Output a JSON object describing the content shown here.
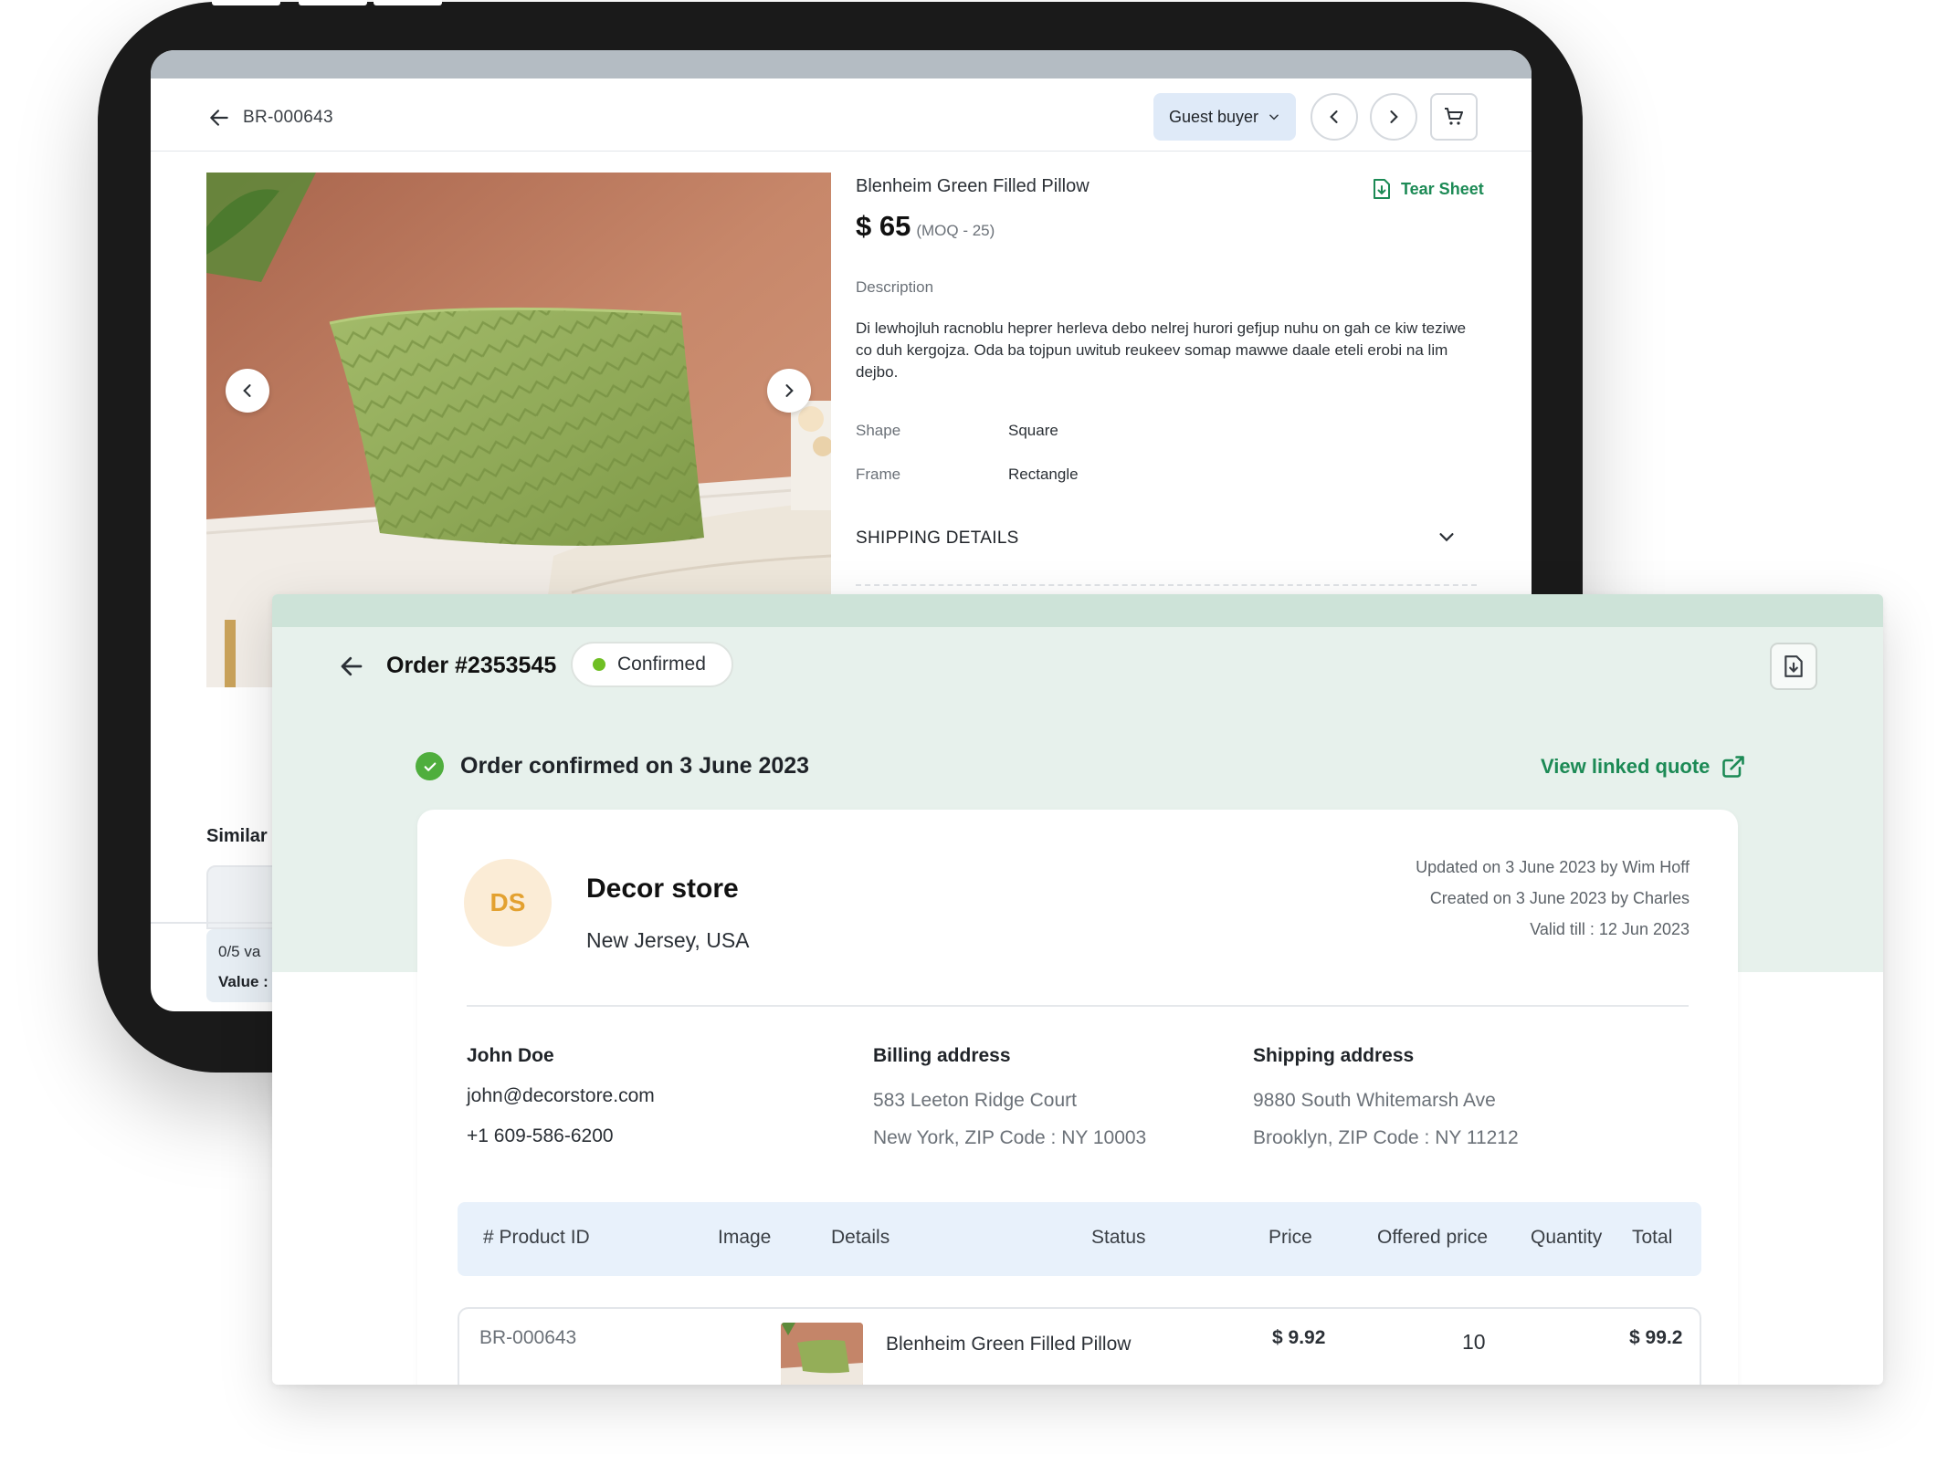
{
  "product_page": {
    "breadcrumb_code": "BR-000643",
    "buyer_select": "Guest buyer",
    "icons": {
      "back": "arrow-left-icon",
      "prev": "chevron-left-icon",
      "next": "chevron-right-icon",
      "cart": "cart-icon",
      "tear_sheet": "file-download-icon"
    },
    "product_name": "Blenheim Green Filled Pillow",
    "price": "$ 65",
    "moq": "(MOQ - 25)",
    "tear_sheet_label": "Tear Sheet",
    "description_label": "Description",
    "description": "Di lewhojluh racnoblu heprer herleva debo nelrej hurori gefjup nuhu on gah ce kiw teziwe co duh kergojza. Oda ba tojpun uwitub reukeev somap mawwe daale eteli erobi na lim dejbo.",
    "attributes": [
      {
        "key": "Shape",
        "value": "Square"
      },
      {
        "key": "Frame",
        "value": "Rectangle"
      }
    ],
    "shipping_label": "SHIPPING DETAILS",
    "similar_label": "Similar",
    "variants_text": "0/5 va",
    "value_text": "Value :"
  },
  "order": {
    "title": "Order #2353545",
    "status": "Confirmed",
    "status_color": "#6fbf24",
    "confirmed_text": "Order confirmed on 3 June 2023",
    "linked_quote": "View linked quote",
    "accent_color": "#1c8a55",
    "store": {
      "initials": "DS",
      "name": "Decor store",
      "location": "New Jersey, USA"
    },
    "meta": {
      "updated": "Updated on 3 June 2023 by Wim Hoff",
      "created": "Created on 3 June 2023 by Charles",
      "valid": "Valid till : 12 Jun 2023"
    },
    "contact": {
      "name": "John Doe",
      "email": "john@decorstore.com",
      "phone": "+1 609-586-6200"
    },
    "billing": {
      "heading": "Billing address",
      "line1": "583 Leeton Ridge Court",
      "line2": "New York, ZIP Code : NY 10003"
    },
    "shipping": {
      "heading": "Shipping address",
      "line1": "9880 South Whitemarsh Ave",
      "line2": "Brooklyn, ZIP Code : NY 11212"
    },
    "table": {
      "headers": [
        "# Product ID",
        "Image",
        "Details",
        "Status",
        "Price",
        "Offered price",
        "Quantity",
        "Total"
      ],
      "rows": [
        {
          "id": "BR-000643",
          "details": "Blenheim Green Filled Pillow",
          "price": "$ 9.92",
          "quantity": "10",
          "total": "$ 99.2"
        }
      ]
    }
  }
}
